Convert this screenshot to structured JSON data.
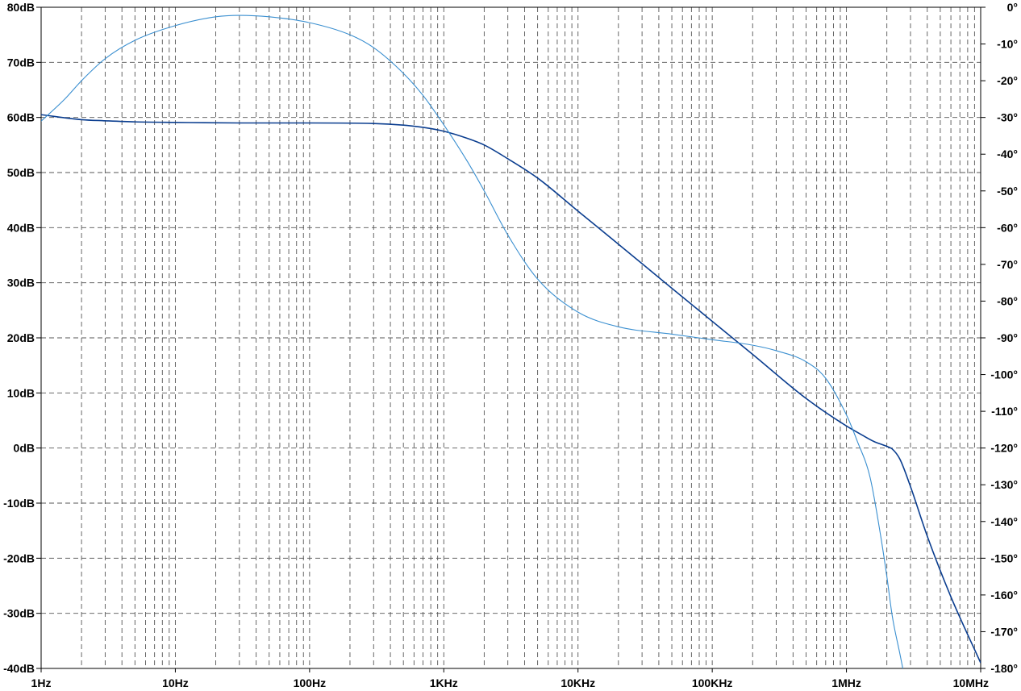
{
  "chart_data": {
    "type": "line",
    "title": "",
    "x_scale": "log",
    "xlim": [
      1,
      10000000
    ],
    "ylim_left": [
      -40,
      80
    ],
    "ylim_right": [
      -180,
      0
    ],
    "grid": true,
    "x_tick_labels": [
      "1Hz",
      "10Hz",
      "100Hz",
      "1KHz",
      "10KHz",
      "100KHz",
      "1MHz",
      "10MHz"
    ],
    "y_left_tick_labels": [
      "80dB",
      "70dB",
      "60dB",
      "50dB",
      "40dB",
      "30dB",
      "20dB",
      "10dB",
      "0dB",
      "-10dB",
      "-20dB",
      "-30dB",
      "-40dB"
    ],
    "y_right_tick_labels": [
      "0°",
      "-10°",
      "-20°",
      "-30°",
      "-40°",
      "-50°",
      "-60°",
      "-70°",
      "-80°",
      "-90°",
      "-100°",
      "-110°",
      "-120°",
      "-130°",
      "-140°",
      "-150°",
      "-160°",
      "-170°",
      "-180°"
    ],
    "series": [
      {
        "axis": "left",
        "unit": "dB",
        "color": "#0a3d8f",
        "x": [
          1,
          2,
          3,
          5,
          10,
          30,
          100,
          300,
          500,
          700,
          1000,
          1500,
          2000,
          3000,
          5000,
          10000,
          20000,
          50000,
          100000,
          200000,
          500000,
          1000000,
          1300000,
          1600000,
          2000000,
          2200000,
          2500000,
          3000000,
          4000000,
          6000000,
          10000000
        ],
        "values": [
          60.5,
          59.6,
          59.4,
          59.2,
          59.1,
          59.0,
          59.0,
          58.9,
          58.6,
          58.2,
          57.5,
          56.2,
          55.0,
          52.5,
          49.0,
          43.0,
          37.0,
          29.0,
          23.0,
          17.0,
          9.0,
          4.0,
          2.4,
          1.2,
          0.3,
          -0.2,
          -2.0,
          -7.0,
          -16.0,
          -27.0,
          -39.0
        ]
      },
      {
        "axis": "right",
        "unit": "deg",
        "color": "#3a8fd0",
        "x": [
          1,
          1.5,
          2,
          3,
          5,
          10,
          20,
          30,
          50,
          100,
          200,
          300,
          500,
          700,
          1000,
          1500,
          2000,
          3000,
          5000,
          10000,
          20000,
          50000,
          100000,
          200000,
          300000,
          500000,
          700000,
          1000000,
          1200000,
          1500000,
          1800000,
          2000000,
          2200000,
          2500000,
          2800000
        ],
        "values": [
          -31,
          -25,
          -20,
          -14,
          -9,
          -5,
          -2.6,
          -2.2,
          -2.6,
          -4.2,
          -7.5,
          -11,
          -18,
          -24,
          -32,
          -42,
          -50,
          -62,
          -74,
          -83,
          -87,
          -89,
          -90.5,
          -92,
          -93.5,
          -96.5,
          -101,
          -111,
          -118,
          -128,
          -144,
          -155,
          -166,
          -176,
          -185
        ]
      }
    ]
  }
}
